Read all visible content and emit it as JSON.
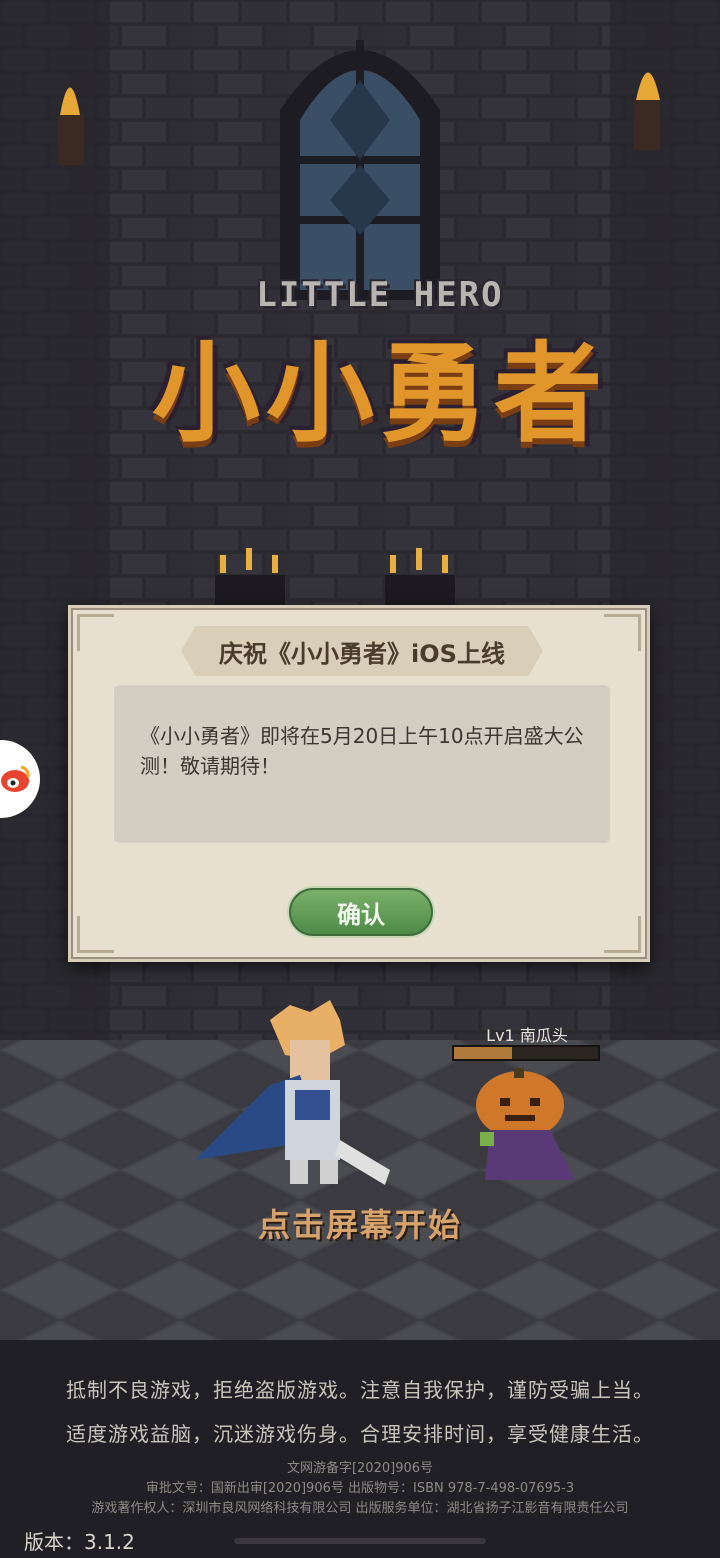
{
  "logo": {
    "en": "LITTLE HERO",
    "cn": "小小勇者"
  },
  "dialog": {
    "title": "庆祝《小小勇者》iOS上线",
    "message": "《小小勇者》即将在5月20日上午10点开启盛大公测！敬请期待！",
    "confirm_label": "确认"
  },
  "side_button": {
    "icon": "weibo-icon"
  },
  "monster": {
    "label": "Lv1 南瓜头",
    "hp_fraction": 0.4
  },
  "tap_start": "点击屏幕开始",
  "notices": {
    "line1": "抵制不良游戏，拒绝盗版游戏。注意自我保护，谨防受骗上当。",
    "line2": "适度游戏益脑，沉迷游戏伤身。合理安排时间，享受健康生活。"
  },
  "legal": {
    "line1": "文网游备字[2020]906号",
    "line2": "审批文号：国新出审[2020]906号  出版物号：ISBN 978-7-498-07695-3",
    "line3": "游戏著作权人：深圳市良风网络科技有限公司  出版服务单位：湖北省扬子江影音有限责任公司"
  },
  "version": "版本：3.1.2",
  "colors": {
    "logo": "#e0962a",
    "confirm": "#5e9a55",
    "tap_text": "#d6a36c"
  }
}
